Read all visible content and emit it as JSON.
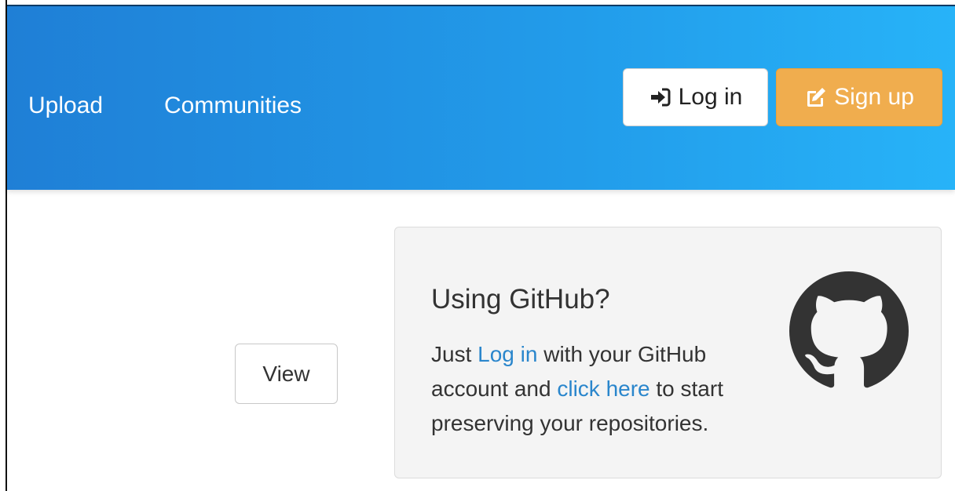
{
  "nav": {
    "links": [
      {
        "label": "Upload"
      },
      {
        "label": "Communities"
      }
    ],
    "login_label": "Log in",
    "signup_label": "Sign up",
    "login_icon": "sign-in-icon",
    "signup_icon": "edit-icon"
  },
  "view_button": {
    "label": "View"
  },
  "github_panel": {
    "title": "Using GitHub?",
    "text_1": "Just ",
    "login_link": "Log in",
    "text_2": " with your GitHub account and ",
    "click_link": "click here",
    "text_3": " to start preserving your repositories.",
    "logo_icon": "github-icon"
  },
  "colors": {
    "navbar_start": "#1f7fd6",
    "navbar_end": "#27b3f8",
    "signup": "#f0ad4e",
    "link": "#2a86cc",
    "panel": "#f4f4f4"
  }
}
